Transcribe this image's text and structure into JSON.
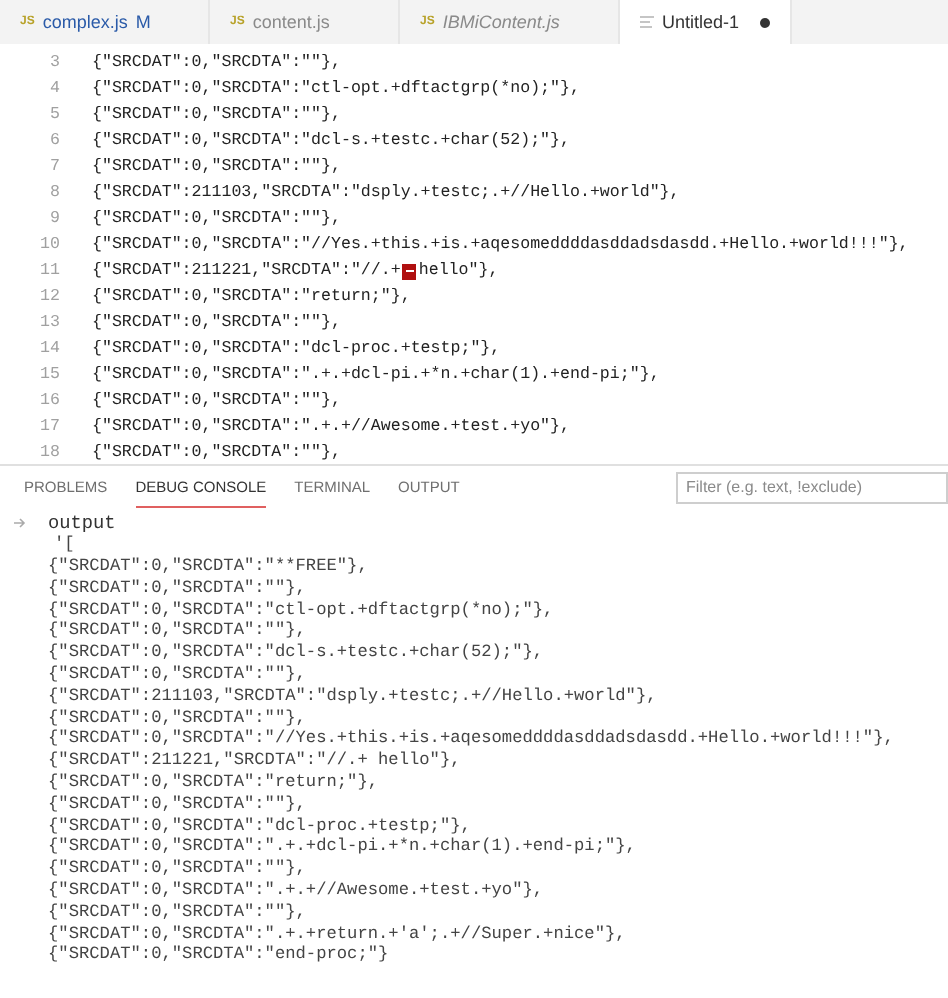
{
  "tabs": [
    {
      "icon_text": "JS",
      "label": "complex.js",
      "git_status": "M",
      "preview": false,
      "dirty": false,
      "selected": false
    },
    {
      "icon_text": "JS",
      "label": "content.js",
      "preview": false,
      "dirty": false,
      "selected": false
    },
    {
      "icon_text": "JS",
      "label": "IBMiContent.js",
      "preview": true,
      "dirty": false,
      "selected": false
    },
    {
      "label": "Untitled-1",
      "preview": false,
      "dirty": true,
      "selected": true
    }
  ],
  "editor": {
    "lines": [
      {
        "number": "3",
        "text": "{\"SRCDAT\":0,\"SRCDTA\":\"\"},"
      },
      {
        "number": "4",
        "text": "{\"SRCDAT\":0,\"SRCDTA\":\"ctl-opt.+dftactgrp(*no);\"},"
      },
      {
        "number": "5",
        "text": "{\"SRCDAT\":0,\"SRCDTA\":\"\"},"
      },
      {
        "number": "6",
        "text": "{\"SRCDAT\":0,\"SRCDTA\":\"dcl-s.+testc.+char(52);\"},"
      },
      {
        "number": "7",
        "text": "{\"SRCDAT\":0,\"SRCDTA\":\"\"},"
      },
      {
        "number": "8",
        "text": "{\"SRCDAT\":211103,\"SRCDTA\":\"dsply.+testc;.+//Hello.+world\"},"
      },
      {
        "number": "9",
        "text": "{\"SRCDAT\":0,\"SRCDTA\":\"\"},"
      },
      {
        "number": "10",
        "text": "{\"SRCDAT\":0,\"SRCDTA\":\"//Yes.+this.+is.+aqesomeddddasddadsdasdd.+Hello.+world!!!\"},"
      },
      {
        "number": "11",
        "text": "{\"SRCDAT\":211221,\"SRCDTA\":\"//.+",
        "control_char": true,
        "text_after": "hello\"},"
      },
      {
        "number": "12",
        "text": "{\"SRCDAT\":0,\"SRCDTA\":\"return;\"},"
      },
      {
        "number": "13",
        "text": "{\"SRCDAT\":0,\"SRCDTA\":\"\"},"
      },
      {
        "number": "14",
        "text": "{\"SRCDAT\":0,\"SRCDTA\":\"dcl-proc.+testp;\"},"
      },
      {
        "number": "15",
        "text": "{\"SRCDAT\":0,\"SRCDTA\":\".+.+dcl-pi.+*n.+char(1).+end-pi;\"},"
      },
      {
        "number": "16",
        "text": "{\"SRCDAT\":0,\"SRCDTA\":\"\"},"
      },
      {
        "number": "17",
        "text": "{\"SRCDAT\":0,\"SRCDTA\":\".+.+//Awesome.+test.+yo\"},"
      },
      {
        "number": "18",
        "text": "{\"SRCDAT\":0,\"SRCDTA\":\"\"},"
      }
    ]
  },
  "panel": {
    "tabs": [
      {
        "label": "PROBLEMS",
        "selected": false
      },
      {
        "label": "DEBUG CONSOLE",
        "selected": true
      },
      {
        "label": "TERMINAL",
        "selected": false
      },
      {
        "label": "OUTPUT",
        "selected": false
      }
    ],
    "filter": {
      "placeholder": "Filter (e.g. text, !exclude)"
    },
    "console": {
      "heading": "output",
      "lines": [
        "'[",
        "{\"SRCDAT\":0,\"SRCDTA\":\"**FREE\"},",
        "{\"SRCDAT\":0,\"SRCDTA\":\"\"},",
        "{\"SRCDAT\":0,\"SRCDTA\":\"ctl-opt.+dftactgrp(*no);\"},",
        "{\"SRCDAT\":0,\"SRCDTA\":\"\"},",
        "{\"SRCDAT\":0,\"SRCDTA\":\"dcl-s.+testc.+char(52);\"},",
        "{\"SRCDAT\":0,\"SRCDTA\":\"\"},",
        "{\"SRCDAT\":211103,\"SRCDTA\":\"dsply.+testc;.+//Hello.+world\"},",
        "{\"SRCDAT\":0,\"SRCDTA\":\"\"},",
        "{\"SRCDAT\":0,\"SRCDTA\":\"//Yes.+this.+is.+aqesomeddddasddadsdasdd.+Hello.+world!!!\"},",
        "{\"SRCDAT\":211221,\"SRCDTA\":\"//.+ hello\"},",
        "{\"SRCDAT\":0,\"SRCDTA\":\"return;\"},",
        "{\"SRCDAT\":0,\"SRCDTA\":\"\"},",
        "{\"SRCDAT\":0,\"SRCDTA\":\"dcl-proc.+testp;\"},",
        "{\"SRCDAT\":0,\"SRCDTA\":\".+.+dcl-pi.+*n.+char(1).+end-pi;\"},",
        "{\"SRCDAT\":0,\"SRCDTA\":\"\"},",
        "{\"SRCDAT\":0,\"SRCDTA\":\".+.+//Awesome.+test.+yo\"},",
        "{\"SRCDAT\":0,\"SRCDTA\":\"\"},",
        "{\"SRCDAT\":0,\"SRCDTA\":\".+.+return.+'a';.+//Super.+nice\"},",
        "{\"SRCDAT\":0,\"SRCDTA\":\"end-proc;\"}"
      ]
    }
  }
}
